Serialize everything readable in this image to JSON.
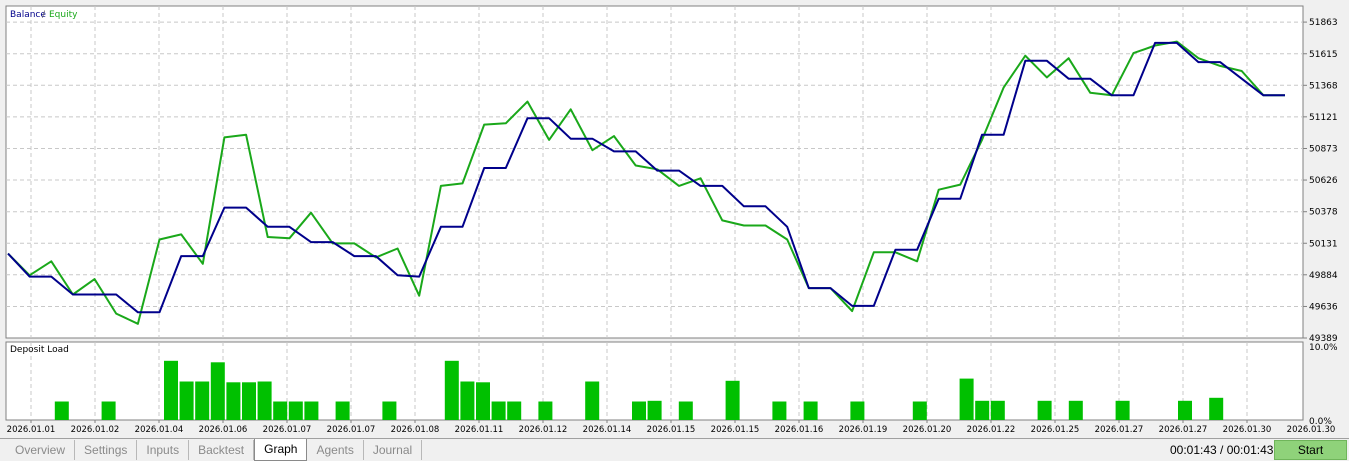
{
  "legend": {
    "balance": "Balance",
    "separator": "/",
    "equity": "Equity"
  },
  "deposit_title": "Deposit Load",
  "tabs": [
    "Overview",
    "Settings",
    "Inputs",
    "Backtest",
    "Graph",
    "Agents",
    "Journal"
  ],
  "active_tab": "Graph",
  "timer": "00:01:43 / 00:01:43",
  "start_label": "Start",
  "colors": {
    "balance": "#00008b",
    "equity": "#1aa81a",
    "deposit_bar": "#00c000",
    "grid": "#c8c8c8"
  },
  "chart_data": [
    {
      "type": "line",
      "series": [
        {
          "name": "Balance",
          "values": [
            50050,
            49870,
            49870,
            49730,
            49730,
            49730,
            49590,
            49590,
            50030,
            50030,
            50410,
            50410,
            50260,
            50260,
            50140,
            50140,
            50030,
            50030,
            49880,
            49870,
            50260,
            50260,
            50720,
            50720,
            51110,
            51110,
            50950,
            50950,
            50850,
            50850,
            50700,
            50700,
            50580,
            50580,
            50420,
            50420,
            50260,
            49780,
            49780,
            49640,
            49640,
            50080,
            50080,
            50480,
            50480,
            50980,
            50980,
            51560,
            51560,
            51420,
            51420,
            51290,
            51290,
            51700,
            51700,
            51550,
            51550,
            51420,
            51290,
            51290
          ]
        },
        {
          "name": "Equity",
          "values": [
            50050,
            49880,
            49990,
            49730,
            49850,
            49580,
            49500,
            50160,
            50200,
            49970,
            50960,
            50980,
            50180,
            50170,
            50370,
            50130,
            50130,
            50020,
            50090,
            49720,
            50580,
            50600,
            51060,
            51070,
            51240,
            50940,
            51180,
            50860,
            50970,
            50740,
            50710,
            50580,
            50640,
            50310,
            50270,
            50270,
            50160,
            49780,
            49780,
            49600,
            50060,
            50060,
            49990,
            50550,
            50590,
            50940,
            51350,
            51600,
            51430,
            51580,
            51310,
            51290,
            51620,
            51680,
            51710,
            51580,
            51520,
            51480,
            51290,
            51290
          ]
        }
      ],
      "ylim": [
        49389,
        51989
      ],
      "yticks": [
        "51863",
        "51615",
        "51368",
        "51121",
        "50873",
        "50626",
        "50378",
        "50131",
        "49884",
        "49636",
        "49389"
      ]
    },
    {
      "type": "bar",
      "title": "Deposit Load",
      "values": [
        0,
        0,
        0,
        2.5,
        0,
        0,
        2.5,
        0,
        0,
        0,
        8,
        5.2,
        5.2,
        7.8,
        5.1,
        5.1,
        5.2,
        2.5,
        2.5,
        2.5,
        0,
        2.5,
        0,
        0,
        2.5,
        0,
        0,
        0,
        8,
        5.2,
        5.1,
        2.5,
        2.5,
        0,
        2.5,
        0,
        0,
        5.2,
        0,
        0,
        2.5,
        2.6,
        0,
        2.5,
        0,
        0,
        5.3,
        0,
        0,
        2.5,
        0,
        2.5,
        0,
        0,
        2.5,
        0,
        0,
        0,
        2.5,
        0,
        0,
        5.6,
        2.6,
        2.6,
        0,
        0,
        2.6,
        0,
        2.6,
        0,
        0,
        2.6,
        0,
        0,
        0,
        2.6,
        0,
        3.0
      ],
      "yticks": [
        "10.0%",
        "0.0%"
      ],
      "ylim": [
        0,
        10
      ]
    }
  ],
  "x_labels": [
    "2026.01.01",
    "2026.01.02",
    "2026.01.04",
    "2026.01.06",
    "2026.01.07",
    "2026.01.07",
    "2026.01.08",
    "2026.01.11",
    "2026.01.12",
    "2026.01.14",
    "2026.01.15",
    "2026.01.15",
    "2026.01.16",
    "2026.01.19",
    "2026.01.20",
    "2026.01.22",
    "2026.01.25",
    "2026.01.27",
    "2026.01.27",
    "2026.01.30",
    "2026.01.30"
  ]
}
